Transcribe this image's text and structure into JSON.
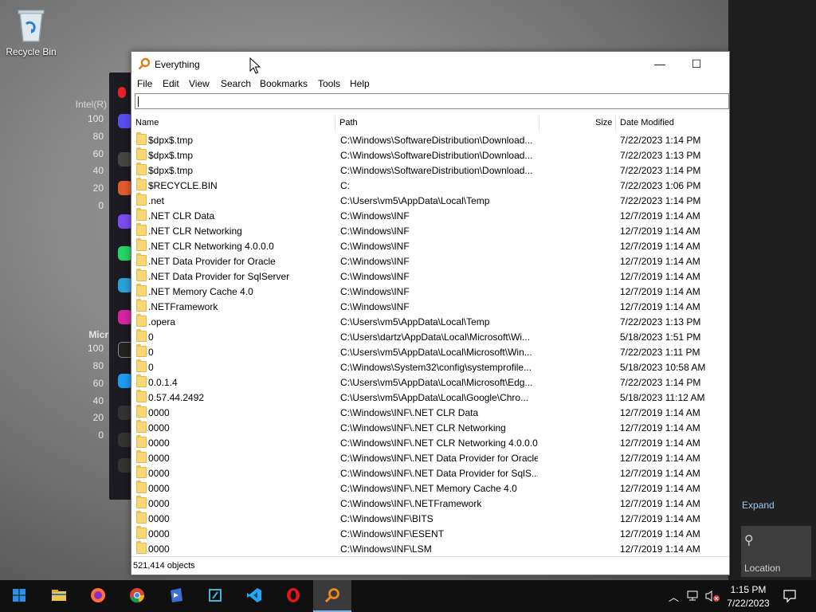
{
  "desktop": {
    "recycle_bin_label": "Recycle Bin"
  },
  "background_app": {
    "labels": [
      "Intel(R)",
      "100",
      "80",
      "60",
      "40",
      "20",
      "0",
      "Micr",
      "100",
      "80",
      "60",
      "40",
      "20",
      "0"
    ]
  },
  "action_center": {
    "expand_label": "Expand",
    "location_label": "Location"
  },
  "window": {
    "title": "Everything",
    "minimize": "—",
    "maximize": "☐",
    "menu": [
      "File",
      "Edit",
      "View",
      "Search",
      "Bookmarks",
      "Tools",
      "Help"
    ],
    "search_value": "",
    "columns": {
      "name": "Name",
      "path": "Path",
      "size": "Size",
      "date": "Date Modified"
    },
    "rows": [
      {
        "name": "$dpx$.tmp",
        "path": "C:\\Windows\\SoftwareDistribution\\Download...",
        "date": "7/22/2023 1:14 PM"
      },
      {
        "name": "$dpx$.tmp",
        "path": "C:\\Windows\\SoftwareDistribution\\Download...",
        "date": "7/22/2023 1:13 PM"
      },
      {
        "name": "$dpx$.tmp",
        "path": "C:\\Windows\\SoftwareDistribution\\Download...",
        "date": "7/22/2023 1:14 PM"
      },
      {
        "name": "$RECYCLE.BIN",
        "path": "C:",
        "date": "7/22/2023 1:06 PM"
      },
      {
        "name": ".net",
        "path": "C:\\Users\\vm5\\AppData\\Local\\Temp",
        "date": "7/22/2023 1:14 PM"
      },
      {
        "name": ".NET CLR Data",
        "path": "C:\\Windows\\INF",
        "date": "12/7/2019 1:14 AM"
      },
      {
        "name": ".NET CLR Networking",
        "path": "C:\\Windows\\INF",
        "date": "12/7/2019 1:14 AM"
      },
      {
        "name": ".NET CLR Networking 4.0.0.0",
        "path": "C:\\Windows\\INF",
        "date": "12/7/2019 1:14 AM"
      },
      {
        "name": ".NET Data Provider for Oracle",
        "path": "C:\\Windows\\INF",
        "date": "12/7/2019 1:14 AM"
      },
      {
        "name": ".NET Data Provider for SqlServer",
        "path": "C:\\Windows\\INF",
        "date": "12/7/2019 1:14 AM"
      },
      {
        "name": ".NET Memory Cache 4.0",
        "path": "C:\\Windows\\INF",
        "date": "12/7/2019 1:14 AM"
      },
      {
        "name": ".NETFramework",
        "path": "C:\\Windows\\INF",
        "date": "12/7/2019 1:14 AM"
      },
      {
        "name": ".opera",
        "path": "C:\\Users\\vm5\\AppData\\Local\\Temp",
        "date": "7/22/2023 1:13 PM"
      },
      {
        "name": "0",
        "path": "C:\\Users\\dartz\\AppData\\Local\\Microsoft\\Wi...",
        "date": "5/18/2023 1:51 PM"
      },
      {
        "name": "0",
        "path": "C:\\Users\\vm5\\AppData\\Local\\Microsoft\\Win...",
        "date": "7/22/2023 1:11 PM"
      },
      {
        "name": "0",
        "path": "C:\\Windows\\System32\\config\\systemprofile...",
        "date": "5/18/2023 10:58 AM"
      },
      {
        "name": "0.0.1.4",
        "path": "C:\\Users\\vm5\\AppData\\Local\\Microsoft\\Edg...",
        "date": "7/22/2023 1:14 PM"
      },
      {
        "name": "0.57.44.2492",
        "path": "C:\\Users\\vm5\\AppData\\Local\\Google\\Chro...",
        "date": "5/18/2023 11:12 AM"
      },
      {
        "name": "0000",
        "path": "C:\\Windows\\INF\\.NET CLR Data",
        "date": "12/7/2019 1:14 AM"
      },
      {
        "name": "0000",
        "path": "C:\\Windows\\INF\\.NET CLR Networking",
        "date": "12/7/2019 1:14 AM"
      },
      {
        "name": "0000",
        "path": "C:\\Windows\\INF\\.NET CLR Networking 4.0.0.0",
        "date": "12/7/2019 1:14 AM"
      },
      {
        "name": "0000",
        "path": "C:\\Windows\\INF\\.NET Data Provider for Oracle",
        "date": "12/7/2019 1:14 AM"
      },
      {
        "name": "0000",
        "path": "C:\\Windows\\INF\\.NET Data Provider for SqlS...",
        "date": "12/7/2019 1:14 AM"
      },
      {
        "name": "0000",
        "path": "C:\\Windows\\INF\\.NET Memory Cache 4.0",
        "date": "12/7/2019 1:14 AM"
      },
      {
        "name": "0000",
        "path": "C:\\Windows\\INF\\.NETFramework",
        "date": "12/7/2019 1:14 AM"
      },
      {
        "name": "0000",
        "path": "C:\\Windows\\INF\\BITS",
        "date": "12/7/2019 1:14 AM"
      },
      {
        "name": "0000",
        "path": "C:\\Windows\\INF\\ESENT",
        "date": "12/7/2019 1:14 AM"
      },
      {
        "name": "0000",
        "path": "C:\\Windows\\INF\\LSM",
        "date": "12/7/2019 1:14 AM"
      }
    ],
    "status": "521,414 objects"
  },
  "taskbar": {
    "apps": [
      "start-icon",
      "file-explorer-icon",
      "firefox-icon",
      "chrome-icon",
      "visual-studio-icon",
      "tool-icon",
      "vscode-icon",
      "opera-icon",
      "everything-icon"
    ],
    "time": "1:15 PM",
    "date": "7/22/2023"
  },
  "colors": {
    "accent": "#7fb3e8",
    "taskbar": "#101010",
    "folder": "#f8d775"
  }
}
